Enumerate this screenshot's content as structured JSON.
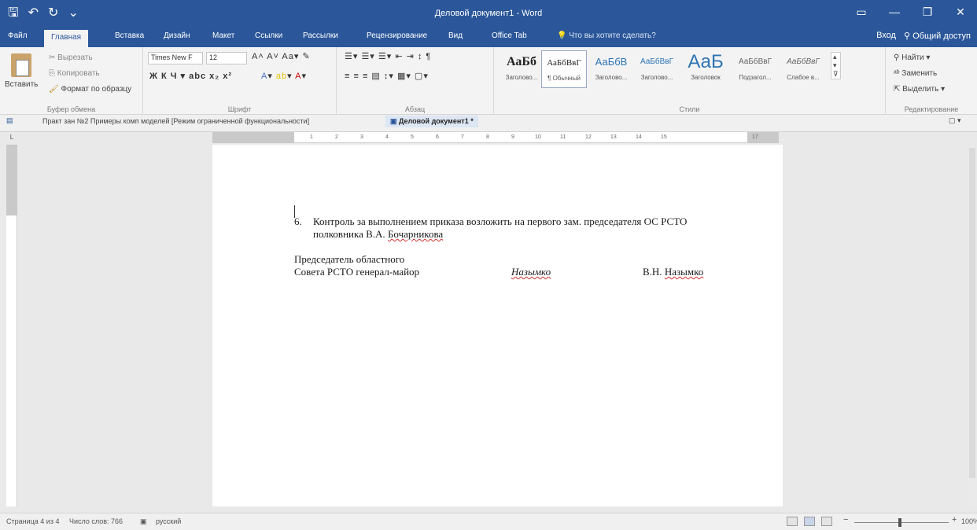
{
  "window": {
    "title": "Деловой документ1 - Word",
    "qat": {
      "save_icon": "save-icon",
      "undo_icon": "undo-icon",
      "redo_icon": "redo-icon",
      "customize": "⌄"
    }
  },
  "tabs": [
    "Файл",
    "Главная",
    "Вставка",
    "Дизайн",
    "Макет",
    "Ссылки",
    "Рассылки",
    "Рецензирование",
    "Вид",
    "Office Tab"
  ],
  "active_tab": "Главная",
  "tell_me": "Что вы хотите сделать?",
  "account": {
    "signin": "Вход",
    "share": "Общий доступ"
  },
  "ribbon": {
    "clipboard": {
      "paste": "Вставить",
      "cut": "Вырезать",
      "copy": "Копировать",
      "format_painter": "Формат по образцу",
      "label": "Буфер обмена"
    },
    "font": {
      "font_name": "Times New F",
      "font_size": "12",
      "label": "Шрифт"
    },
    "paragraph": {
      "label": "Абзац"
    },
    "styles": {
      "label": "Стили",
      "items": [
        {
          "sample": "АаБб",
          "name": "Заголово..."
        },
        {
          "sample": "АаБбВвГ",
          "name": "¶ Обычный"
        },
        {
          "sample": "АаБбВ",
          "name": "Заголово..."
        },
        {
          "sample": "АаБбВвГ",
          "name": "Заголово..."
        },
        {
          "sample": "АаБ",
          "name": "Заголовок"
        },
        {
          "sample": "АаБбВвГ",
          "name": "Подзагол..."
        },
        {
          "sample": "АаБбВвГ",
          "name": "Слабое в..."
        }
      ]
    },
    "editing": {
      "find": "Найти",
      "replace": "Заменить",
      "select": "Выделить",
      "label": "Редактирование"
    }
  },
  "doc_tabs": [
    "Практ зан №2 Примеры комп моделей [Режим ограниченной функциональности]",
    "Деловой документ1 *"
  ],
  "ruler_ticks": [
    "1",
    "2",
    "3",
    "4",
    "5",
    "6",
    "7",
    "8",
    "9",
    "10",
    "11",
    "12",
    "13",
    "14",
    "15",
    "17"
  ],
  "document": {
    "item_num": "6.",
    "line1": "Контроль за выполнением приказа возложить на первого зам. председателя ОС РСТО",
    "line2_plain": "полковника В.А.",
    "line2_name": "Бочарникова",
    "sig_line1": "Председатель областного",
    "sig_line2": "Совета РСТО генерал-майор",
    "signature": "Назымко",
    "sig_initials": "В.Н.",
    "sig_surname": "Назымко"
  },
  "status": {
    "page": "Страница 4 из 4",
    "words": "Число слов: 766",
    "language": "русский",
    "zoom": "100%"
  }
}
